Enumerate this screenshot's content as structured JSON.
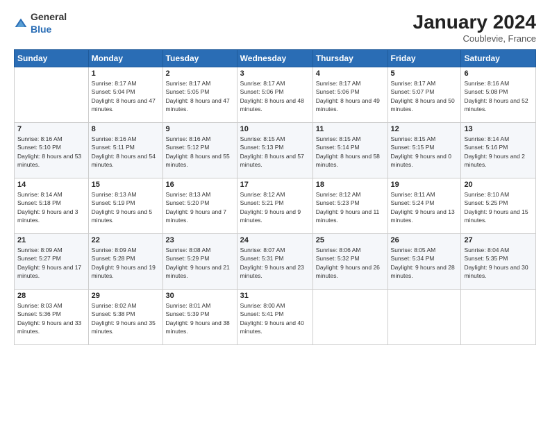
{
  "header": {
    "logo_general": "General",
    "logo_blue": "Blue",
    "title": "January 2024",
    "location": "Coublevie, France"
  },
  "weekdays": [
    "Sunday",
    "Monday",
    "Tuesday",
    "Wednesday",
    "Thursday",
    "Friday",
    "Saturday"
  ],
  "weeks": [
    [
      {
        "day": "",
        "sunrise": "",
        "sunset": "",
        "daylight": ""
      },
      {
        "day": "1",
        "sunrise": "Sunrise: 8:17 AM",
        "sunset": "Sunset: 5:04 PM",
        "daylight": "Daylight: 8 hours and 47 minutes."
      },
      {
        "day": "2",
        "sunrise": "Sunrise: 8:17 AM",
        "sunset": "Sunset: 5:05 PM",
        "daylight": "Daylight: 8 hours and 47 minutes."
      },
      {
        "day": "3",
        "sunrise": "Sunrise: 8:17 AM",
        "sunset": "Sunset: 5:06 PM",
        "daylight": "Daylight: 8 hours and 48 minutes."
      },
      {
        "day": "4",
        "sunrise": "Sunrise: 8:17 AM",
        "sunset": "Sunset: 5:06 PM",
        "daylight": "Daylight: 8 hours and 49 minutes."
      },
      {
        "day": "5",
        "sunrise": "Sunrise: 8:17 AM",
        "sunset": "Sunset: 5:07 PM",
        "daylight": "Daylight: 8 hours and 50 minutes."
      },
      {
        "day": "6",
        "sunrise": "Sunrise: 8:16 AM",
        "sunset": "Sunset: 5:08 PM",
        "daylight": "Daylight: 8 hours and 52 minutes."
      }
    ],
    [
      {
        "day": "7",
        "sunrise": "Sunrise: 8:16 AM",
        "sunset": "Sunset: 5:10 PM",
        "daylight": "Daylight: 8 hours and 53 minutes."
      },
      {
        "day": "8",
        "sunrise": "Sunrise: 8:16 AM",
        "sunset": "Sunset: 5:11 PM",
        "daylight": "Daylight: 8 hours and 54 minutes."
      },
      {
        "day": "9",
        "sunrise": "Sunrise: 8:16 AM",
        "sunset": "Sunset: 5:12 PM",
        "daylight": "Daylight: 8 hours and 55 minutes."
      },
      {
        "day": "10",
        "sunrise": "Sunrise: 8:15 AM",
        "sunset": "Sunset: 5:13 PM",
        "daylight": "Daylight: 8 hours and 57 minutes."
      },
      {
        "day": "11",
        "sunrise": "Sunrise: 8:15 AM",
        "sunset": "Sunset: 5:14 PM",
        "daylight": "Daylight: 8 hours and 58 minutes."
      },
      {
        "day": "12",
        "sunrise": "Sunrise: 8:15 AM",
        "sunset": "Sunset: 5:15 PM",
        "daylight": "Daylight: 9 hours and 0 minutes."
      },
      {
        "day": "13",
        "sunrise": "Sunrise: 8:14 AM",
        "sunset": "Sunset: 5:16 PM",
        "daylight": "Daylight: 9 hours and 2 minutes."
      }
    ],
    [
      {
        "day": "14",
        "sunrise": "Sunrise: 8:14 AM",
        "sunset": "Sunset: 5:18 PM",
        "daylight": "Daylight: 9 hours and 3 minutes."
      },
      {
        "day": "15",
        "sunrise": "Sunrise: 8:13 AM",
        "sunset": "Sunset: 5:19 PM",
        "daylight": "Daylight: 9 hours and 5 minutes."
      },
      {
        "day": "16",
        "sunrise": "Sunrise: 8:13 AM",
        "sunset": "Sunset: 5:20 PM",
        "daylight": "Daylight: 9 hours and 7 minutes."
      },
      {
        "day": "17",
        "sunrise": "Sunrise: 8:12 AM",
        "sunset": "Sunset: 5:21 PM",
        "daylight": "Daylight: 9 hours and 9 minutes."
      },
      {
        "day": "18",
        "sunrise": "Sunrise: 8:12 AM",
        "sunset": "Sunset: 5:23 PM",
        "daylight": "Daylight: 9 hours and 11 minutes."
      },
      {
        "day": "19",
        "sunrise": "Sunrise: 8:11 AM",
        "sunset": "Sunset: 5:24 PM",
        "daylight": "Daylight: 9 hours and 13 minutes."
      },
      {
        "day": "20",
        "sunrise": "Sunrise: 8:10 AM",
        "sunset": "Sunset: 5:25 PM",
        "daylight": "Daylight: 9 hours and 15 minutes."
      }
    ],
    [
      {
        "day": "21",
        "sunrise": "Sunrise: 8:09 AM",
        "sunset": "Sunset: 5:27 PM",
        "daylight": "Daylight: 9 hours and 17 minutes."
      },
      {
        "day": "22",
        "sunrise": "Sunrise: 8:09 AM",
        "sunset": "Sunset: 5:28 PM",
        "daylight": "Daylight: 9 hours and 19 minutes."
      },
      {
        "day": "23",
        "sunrise": "Sunrise: 8:08 AM",
        "sunset": "Sunset: 5:29 PM",
        "daylight": "Daylight: 9 hours and 21 minutes."
      },
      {
        "day": "24",
        "sunrise": "Sunrise: 8:07 AM",
        "sunset": "Sunset: 5:31 PM",
        "daylight": "Daylight: 9 hours and 23 minutes."
      },
      {
        "day": "25",
        "sunrise": "Sunrise: 8:06 AM",
        "sunset": "Sunset: 5:32 PM",
        "daylight": "Daylight: 9 hours and 26 minutes."
      },
      {
        "day": "26",
        "sunrise": "Sunrise: 8:05 AM",
        "sunset": "Sunset: 5:34 PM",
        "daylight": "Daylight: 9 hours and 28 minutes."
      },
      {
        "day": "27",
        "sunrise": "Sunrise: 8:04 AM",
        "sunset": "Sunset: 5:35 PM",
        "daylight": "Daylight: 9 hours and 30 minutes."
      }
    ],
    [
      {
        "day": "28",
        "sunrise": "Sunrise: 8:03 AM",
        "sunset": "Sunset: 5:36 PM",
        "daylight": "Daylight: 9 hours and 33 minutes."
      },
      {
        "day": "29",
        "sunrise": "Sunrise: 8:02 AM",
        "sunset": "Sunset: 5:38 PM",
        "daylight": "Daylight: 9 hours and 35 minutes."
      },
      {
        "day": "30",
        "sunrise": "Sunrise: 8:01 AM",
        "sunset": "Sunset: 5:39 PM",
        "daylight": "Daylight: 9 hours and 38 minutes."
      },
      {
        "day": "31",
        "sunrise": "Sunrise: 8:00 AM",
        "sunset": "Sunset: 5:41 PM",
        "daylight": "Daylight: 9 hours and 40 minutes."
      },
      {
        "day": "",
        "sunrise": "",
        "sunset": "",
        "daylight": ""
      },
      {
        "day": "",
        "sunrise": "",
        "sunset": "",
        "daylight": ""
      },
      {
        "day": "",
        "sunrise": "",
        "sunset": "",
        "daylight": ""
      }
    ]
  ]
}
